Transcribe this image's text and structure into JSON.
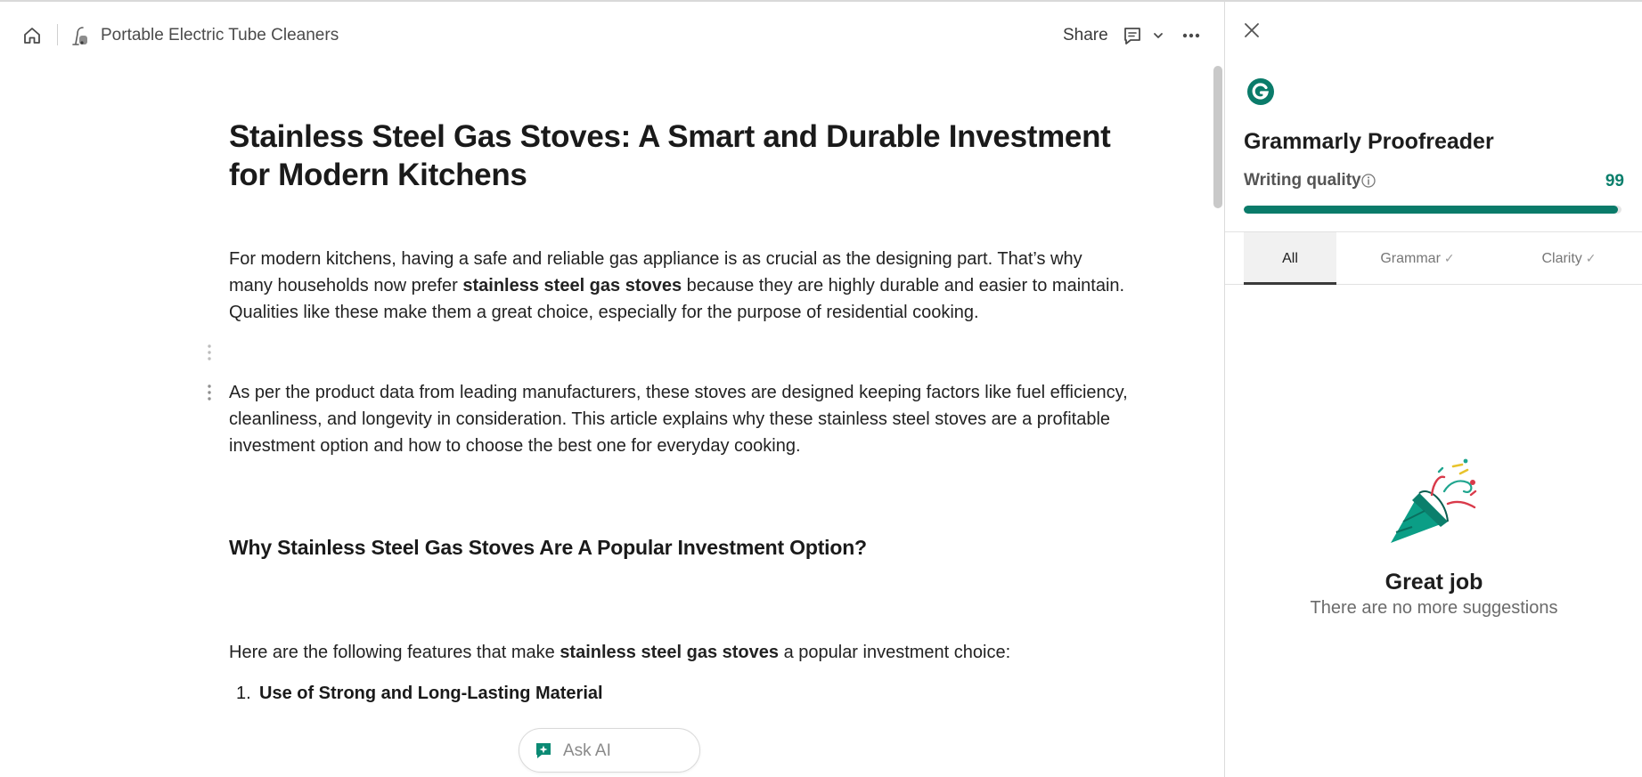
{
  "header": {
    "page_title": "Portable Electric Tube Cleaners",
    "share_label": "Share"
  },
  "document": {
    "title": "Stainless Steel Gas Stoves: A Smart and Durable Investment for Modern Kitchens",
    "paragraph1": {
      "before": "For modern kitchens, having a safe and reliable gas appliance is as crucial as the designing part. That’s why many households now prefer ",
      "bold": "stainless steel gas stoves",
      "after": " because they are highly durable and easier to maintain. Qualities like these make them a great choice, especially for the purpose of residential cooking."
    },
    "paragraph2": "As per the product data from leading manufacturers, these stoves are designed keeping factors like fuel efficiency, cleanliness, and longevity in consideration. This article explains why these stainless steel stoves are a profitable investment option and how to choose the best one for everyday cooking.",
    "heading2": "Why Stainless Steel Gas Stoves Are A Popular Investment Option?",
    "paragraph3": {
      "before": "Here are the following features that make ",
      "bold": "stainless steel gas stoves",
      "after": " a popular investment choice:"
    },
    "list": [
      {
        "number": "1.",
        "text": "Use of Strong and Long-Lasting Material"
      }
    ]
  },
  "ask_ai": {
    "label": "Ask AI"
  },
  "grammarly": {
    "title": "Grammarly Proofreader",
    "writing_quality_label": "Writing quality",
    "writing_quality_score": "99",
    "writing_quality_fraction": 0.99,
    "tabs": [
      {
        "label": "All",
        "active": true
      },
      {
        "label": "Grammar",
        "check": "✓"
      },
      {
        "label": "Clarity",
        "check": "✓"
      }
    ],
    "empty_title": "Great job",
    "empty_subtitle": "There are no more suggestions"
  },
  "colors": {
    "grammarly_green": "#0a7b6a",
    "ai_green": "#0b8a74"
  },
  "icons": {
    "home": "home-icon",
    "page": "vacuum-icon",
    "comment": "comment-icon",
    "chevron": "chevron-down-icon",
    "more": "more-horizontal-icon",
    "close": "close-icon",
    "grammarly": "grammarly-logo-icon",
    "info": "info-icon",
    "ai": "ai-chat-icon",
    "party": "party-popper-icon"
  }
}
